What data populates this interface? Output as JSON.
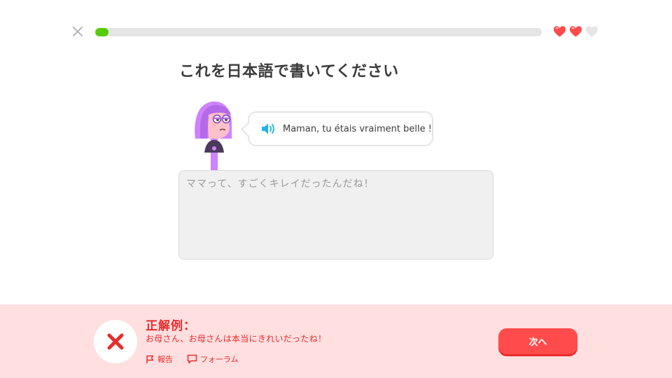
{
  "progress": {
    "fraction": 0.03,
    "fill_color": "#58cc02"
  },
  "hearts": {
    "total": 3,
    "remaining": 2,
    "filled_color": "#ff4b4b",
    "empty_color": "#e5e5e5"
  },
  "prompt": {
    "title": "これを日本語で書いてください"
  },
  "bubble": {
    "text": "Maman, tu étais vraiment belle !"
  },
  "answer": {
    "value": "ママって、すごくキレイだったんだね！"
  },
  "feedback": {
    "title": "正解例：",
    "correct_answer": "お母さん、お母さんは本当にきれいだったね！",
    "report_label": "報告",
    "forum_label": "フォーラム",
    "next_label": "次へ",
    "accent_color": "#ea2b2b"
  }
}
